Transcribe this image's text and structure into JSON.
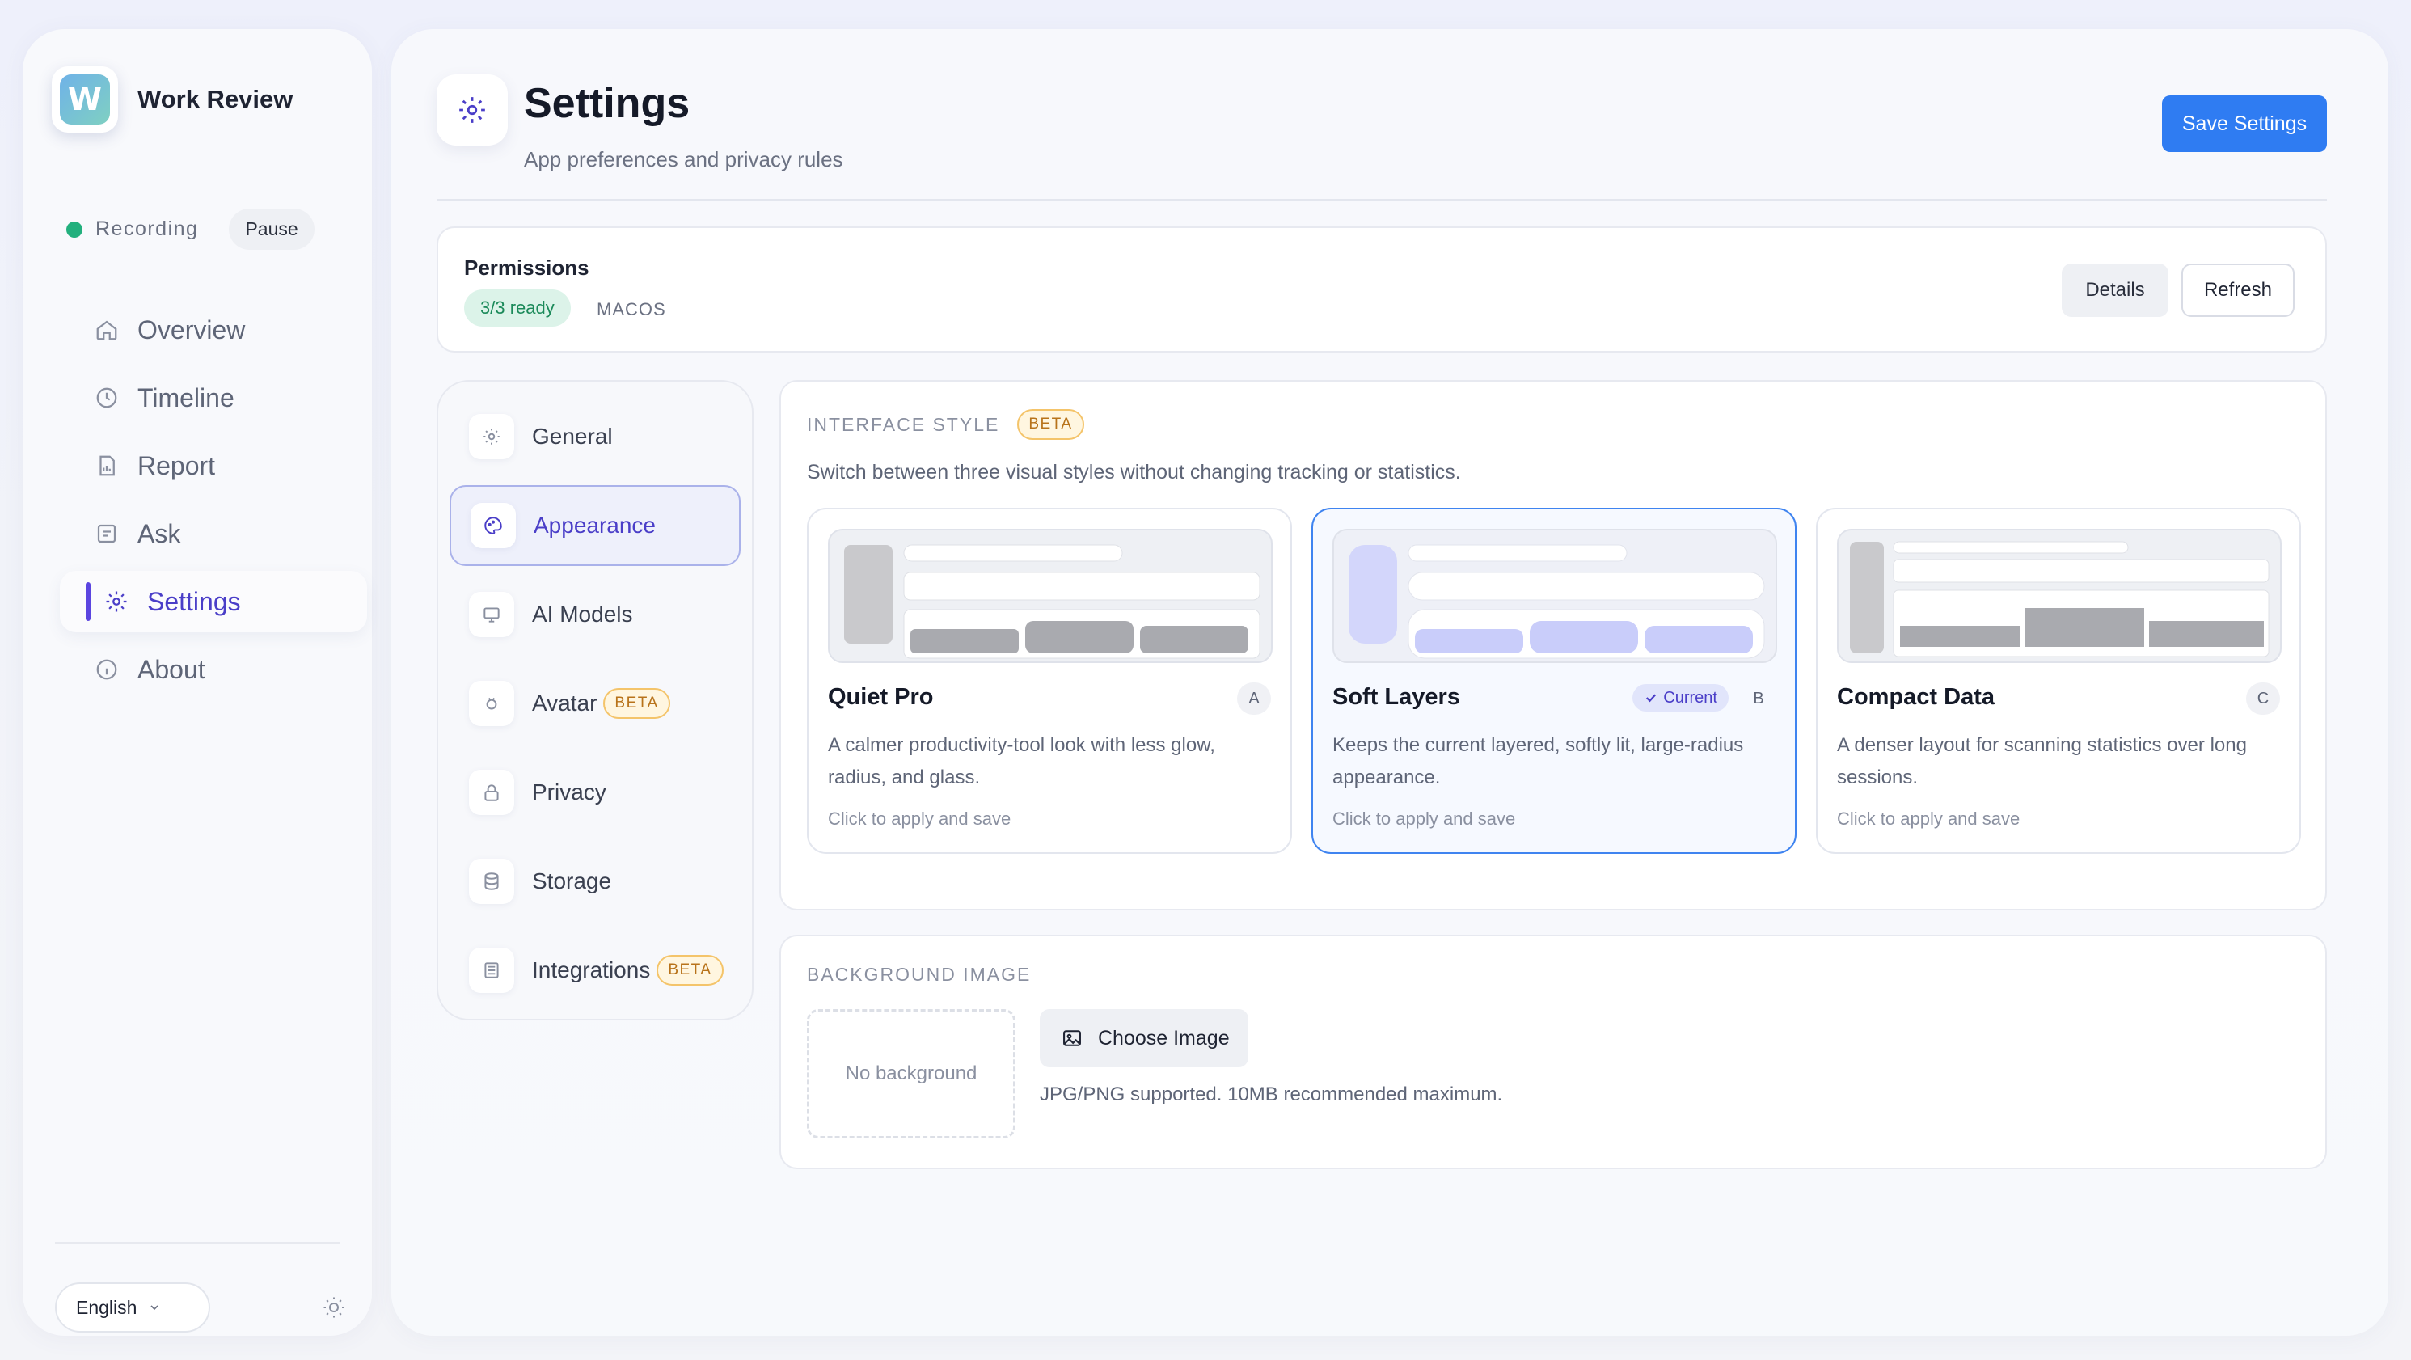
{
  "app": {
    "name": "Work Review",
    "logo_letter": "W"
  },
  "recording": {
    "status": "Recording",
    "pause_label": "Pause"
  },
  "nav": [
    {
      "label": "Overview",
      "icon": "home-icon"
    },
    {
      "label": "Timeline",
      "icon": "clock-icon"
    },
    {
      "label": "Report",
      "icon": "report-icon"
    },
    {
      "label": "Ask",
      "icon": "chat-icon"
    },
    {
      "label": "Settings",
      "icon": "gear-icon",
      "active": true
    },
    {
      "label": "About",
      "icon": "info-icon"
    }
  ],
  "footer": {
    "language": "English"
  },
  "page": {
    "title": "Settings",
    "subtitle": "App preferences and privacy rules",
    "save_label": "Save Settings"
  },
  "permissions": {
    "title": "Permissions",
    "badge": "3/3 ready",
    "os": "MACOS",
    "details_label": "Details",
    "refresh_label": "Refresh"
  },
  "subnav": [
    {
      "label": "General",
      "icon": "gear-icon"
    },
    {
      "label": "Appearance",
      "icon": "palette-icon",
      "active": true
    },
    {
      "label": "AI Models",
      "icon": "monitor-icon"
    },
    {
      "label": "Avatar",
      "icon": "avatar-icon",
      "beta": "BETA"
    },
    {
      "label": "Privacy",
      "icon": "lock-icon"
    },
    {
      "label": "Storage",
      "icon": "database-icon"
    },
    {
      "label": "Integrations",
      "icon": "integrations-icon",
      "beta": "BETA"
    }
  ],
  "interface_style": {
    "label": "INTERFACE STYLE",
    "beta": "BETA",
    "description": "Switch between three visual styles without changing tracking or statistics.",
    "options": [
      {
        "title": "Quiet Pro",
        "letter": "A",
        "description": "A calmer productivity-tool look with less glow, radius, and glass.",
        "hint": "Click to apply and save"
      },
      {
        "title": "Soft Layers",
        "letter": "B",
        "current_label": "Current",
        "description": "Keeps the current layered, softly lit, large-radius appearance.",
        "hint": "Click to apply and save"
      },
      {
        "title": "Compact Data",
        "letter": "C",
        "description": "A denser layout for scanning statistics over long sessions.",
        "hint": "Click to apply and save"
      }
    ]
  },
  "background_image": {
    "label": "BACKGROUND IMAGE",
    "placeholder": "No background",
    "choose_label": "Choose Image",
    "hint": "JPG/PNG supported. 10MB recommended maximum."
  },
  "colors": {
    "accent": "#2f7cf2",
    "active_nav": "#4a3ec8",
    "success": "#22b07d",
    "beta": "#b8731a"
  }
}
